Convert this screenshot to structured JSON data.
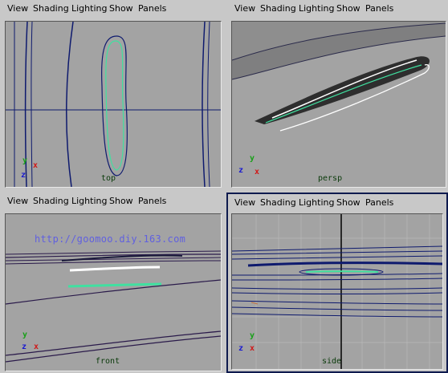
{
  "menu": [
    "View",
    "Shading",
    "Lighting",
    "Show",
    "Panels"
  ],
  "panels": [
    {
      "camera": "top"
    },
    {
      "camera": "persp"
    },
    {
      "camera": "front",
      "overlay": "http://goomoo.diy.163.com"
    },
    {
      "camera": "side"
    }
  ],
  "axes": {
    "x": "x",
    "y": "y",
    "z": "z"
  },
  "colors": {
    "viewport": "#a3a3a3",
    "curve": "#0e1a6e",
    "selected_curve": "#40e0a0",
    "active_border": "#0e1a4e"
  }
}
